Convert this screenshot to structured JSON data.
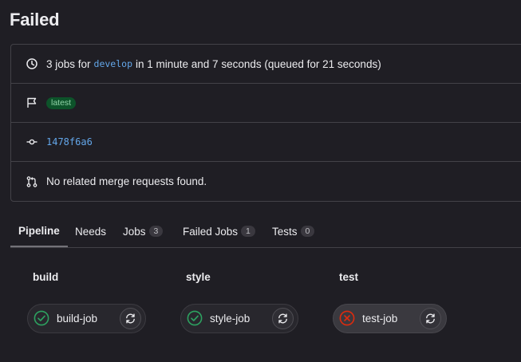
{
  "page": {
    "title": "Failed"
  },
  "info": {
    "summary": {
      "prefix": "3 jobs for",
      "branch": "develop",
      "suffix": "in 1 minute and 7 seconds (queued for 21 seconds)"
    },
    "badge": "latest",
    "commit_sha": "1478f6a6",
    "merge_requests": "No related merge requests found."
  },
  "tabs": [
    {
      "label": "Pipeline",
      "count": null
    },
    {
      "label": "Needs",
      "count": null
    },
    {
      "label": "Jobs",
      "count": "3"
    },
    {
      "label": "Failed Jobs",
      "count": "1"
    },
    {
      "label": "Tests",
      "count": "0"
    }
  ],
  "stages": [
    {
      "title": "build",
      "job": {
        "name": "build-job",
        "status": "success"
      }
    },
    {
      "title": "style",
      "job": {
        "name": "style-job",
        "status": "success"
      }
    },
    {
      "title": "test",
      "job": {
        "name": "test-job",
        "status": "failed"
      }
    }
  ],
  "colors": {
    "background": "#1f1e24",
    "link": "#63a6e9",
    "success": "#2da160",
    "failed": "#dd2b0e",
    "badge_bg": "#0d532a",
    "badge_text": "#91d4a8"
  },
  "icons": {
    "summary": "clock-icon",
    "badge": "flag-icon",
    "commit": "commit-icon",
    "merge": "merge-request-icon",
    "success": "status-success-icon",
    "failed": "status-failed-icon",
    "retry": "retry-icon"
  }
}
